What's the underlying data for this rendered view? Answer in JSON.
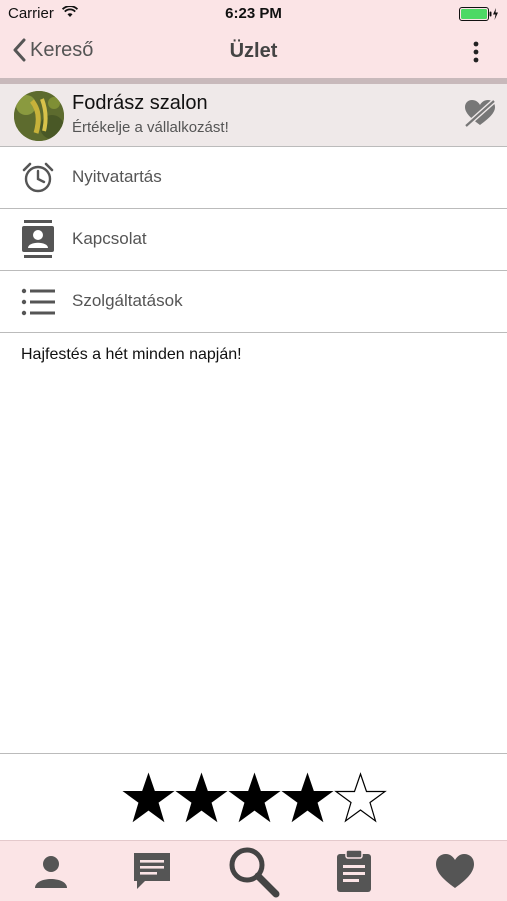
{
  "status_bar": {
    "carrier": "Carrier",
    "time": "6:23 PM"
  },
  "nav": {
    "back_label": "Kereső",
    "title": "Üzlet"
  },
  "business": {
    "name": "Fodrász szalon",
    "subtitle": "Értékelje a vállalkozást!"
  },
  "menu": [
    {
      "label": "Nyitvatartás",
      "icon": "alarm-clock-icon"
    },
    {
      "label": "Kapcsolat",
      "icon": "contact-card-icon"
    },
    {
      "label": "Szolgáltatások",
      "icon": "list-icon"
    }
  ],
  "description": "Hajfestés a hét minden napján!",
  "rating": {
    "value": 4,
    "max": 5
  },
  "tabs": [
    {
      "name": "profile",
      "icon": "person-icon"
    },
    {
      "name": "messages",
      "icon": "chat-icon"
    },
    {
      "name": "search",
      "icon": "search-icon",
      "active": true
    },
    {
      "name": "clipboard",
      "icon": "clipboard-icon"
    },
    {
      "name": "favorites",
      "icon": "heart-icon"
    }
  ],
  "colors": {
    "bar_background": "#fbe4e6",
    "icon_gray": "#555555",
    "header_background": "#efe9e9",
    "battery_green": "#4cd964"
  }
}
